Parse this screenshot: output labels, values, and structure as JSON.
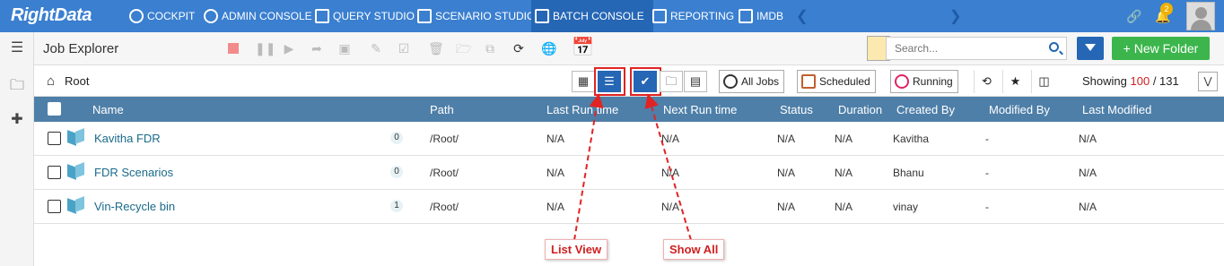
{
  "nav": {
    "logo": "RightData",
    "items": [
      {
        "label": "COCKPIT"
      },
      {
        "label": "ADMIN CONSOLE"
      },
      {
        "label": "QUERY STUDIO"
      },
      {
        "label": "SCENARIO STUDIO"
      },
      {
        "label": "BATCH CONSOLE"
      },
      {
        "label": "REPORTING"
      },
      {
        "label": "IMDB"
      }
    ],
    "active": "BATCH CONSOLE",
    "notification_count": "2"
  },
  "toolbar": {
    "title": "Job Explorer",
    "search_placeholder": "Search...",
    "new_folder_label": "+ New Folder"
  },
  "subbar": {
    "breadcrumb": "Root",
    "all_jobs_label": "All Jobs",
    "scheduled_label": "Scheduled",
    "running_label": "Running",
    "showing_prefix": "Showing",
    "showing_count": "100",
    "showing_total": "/ 131"
  },
  "table": {
    "columns": [
      "Name",
      "Path",
      "Last Run time",
      "Next Run time",
      "Status",
      "Duration",
      "Created By",
      "Modified By",
      "Last Modified"
    ],
    "rows": [
      {
        "name": "Kavitha FDR",
        "count": "0",
        "path": "/Root/",
        "last_run": "N/A",
        "next_run": "N/A",
        "status": "N/A",
        "duration": "N/A",
        "created_by": "Kavitha",
        "modified_by": "-",
        "last_modified": "N/A"
      },
      {
        "name": "FDR Scenarios",
        "count": "0",
        "path": "/Root/",
        "last_run": "N/A",
        "next_run": "N/A",
        "status": "N/A",
        "duration": "N/A",
        "created_by": "Bhanu",
        "modified_by": "-",
        "last_modified": "N/A"
      },
      {
        "name": "Vin-Recycle bin",
        "count": "1",
        "path": "/Root/",
        "last_run": "N/A",
        "next_run": "N/A",
        "status": "N/A",
        "duration": "N/A",
        "created_by": "vinay",
        "modified_by": "-",
        "last_modified": "N/A"
      }
    ]
  },
  "annotations": {
    "list_view": "List View",
    "show_all": "Show All",
    "color": "#e02424"
  },
  "colors": {
    "nav_bg": "#3a7fd0",
    "accent": "#2566b5",
    "header_bg": "#4e7fa8",
    "new_folder": "#3cb64c"
  }
}
